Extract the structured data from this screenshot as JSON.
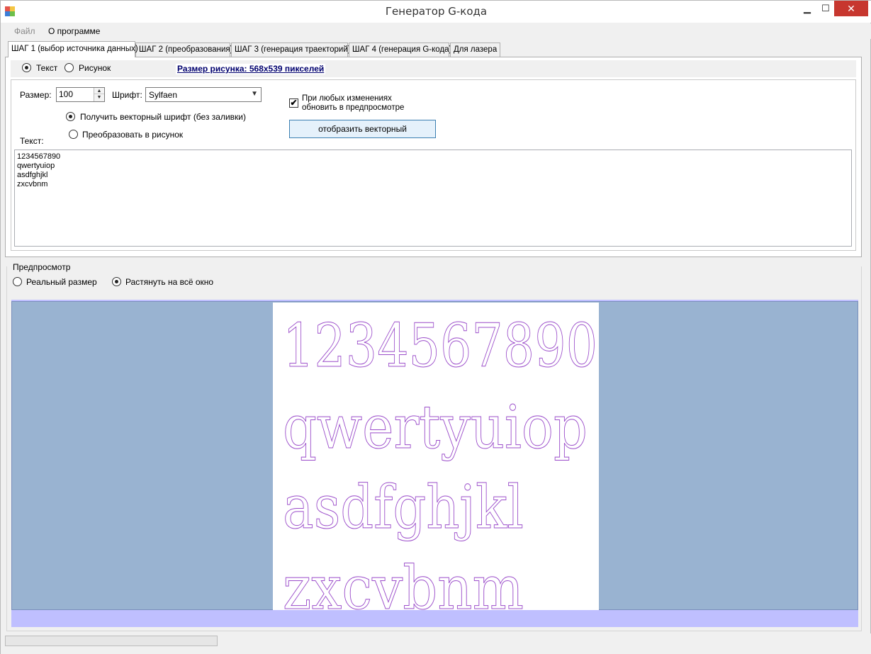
{
  "window": {
    "title": "Генератор G-кода",
    "close_glyph": "✕",
    "minimize_glyph": "▁",
    "maximize_glyph": "☐"
  },
  "menu": {
    "file": "Файл",
    "about": "О программе"
  },
  "tabs": [
    {
      "label": "ШАГ 1 (выбор источника данных)",
      "active": true
    },
    {
      "label": "ШАГ 2 (преобразования)",
      "active": false
    },
    {
      "label": "ШАГ 3 (генерация траекторий)",
      "active": false
    },
    {
      "label": "ШАГ 4 (генерация G-кода)",
      "active": false
    },
    {
      "label": "Для лазера",
      "active": false
    }
  ],
  "source": {
    "text_label": "Текст",
    "text_selected": true,
    "image_label": "Рисунок",
    "image_selected": false
  },
  "size_info": "Размер рисунка: 568x539 пикселей",
  "params": {
    "size_label": "Размер:",
    "size_value": "100",
    "font_label": "Шрифт:",
    "font_value": "Sylfaen",
    "vector_font_option": "Получить векторный шрифт (без заливки)",
    "vector_font_selected": true,
    "to_image_option": "Преобразовать в рисунок",
    "to_image_selected": false,
    "auto_update_line1": "При любых изменениях",
    "auto_update_line2": "обновить в предпросмотре",
    "auto_update_checked": true,
    "check_glyph": "✔",
    "show_vector_button": "отобразить векторный",
    "text_label": "Текст:",
    "text_lines": [
      "1234567890",
      "qwertyuiop",
      "asdfghjkl",
      "zxcvbnm"
    ]
  },
  "preview": {
    "legend": "Предпросмотр",
    "real_size_label": "Реальный размер",
    "real_size_selected": false,
    "stretch_label": "Растянуть на всё окно",
    "stretch_selected": true,
    "rendered_lines": [
      "1234567890",
      "qwertyuiop",
      "asdfghjkl",
      "zxcvbnm"
    ],
    "outline_color": "#9b4dca",
    "background_color": "#99b3d1",
    "frame_color": "#bfbfff"
  },
  "status": {
    "progress": 0
  }
}
